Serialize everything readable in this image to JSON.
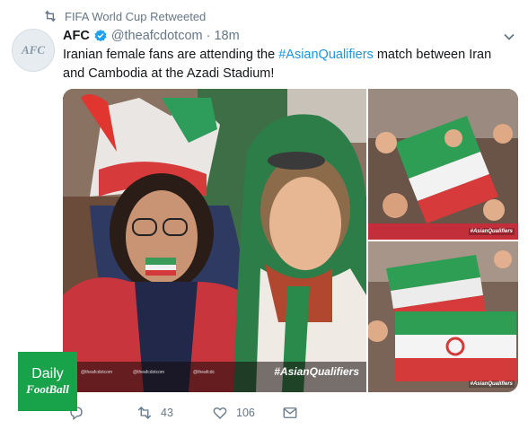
{
  "retweet_context": {
    "text": "FIFA World Cup Retweeted",
    "icon": "retweet-icon"
  },
  "author": {
    "name": "AFC",
    "handle": "@theafcdotcom",
    "separator": "·",
    "time": "18m",
    "verified": true,
    "avatar_text": "AFC"
  },
  "tweet": {
    "text_before": "Iranian female fans are attending the ",
    "hashtag": "#AsianQualifiers",
    "text_after": " match between Iran and Cambodia at the Azadi Stadium!"
  },
  "media": {
    "main_hashtag": "#AsianQualifiers",
    "main_credits": [
      "@theafcdotcom",
      "@theafcdotcom",
      "@theafcdc"
    ],
    "thumb_hashtag": "#AsianQualifiers"
  },
  "actions": {
    "reply_count": "",
    "retweet_count": "43",
    "like_count": "106"
  },
  "watermark": {
    "line1": "Daily",
    "line2": "FootBall"
  },
  "colors": {
    "link": "#1b95e0",
    "muted": "#657786",
    "watermark": "#18a24a",
    "verified": "#1da1f2"
  }
}
